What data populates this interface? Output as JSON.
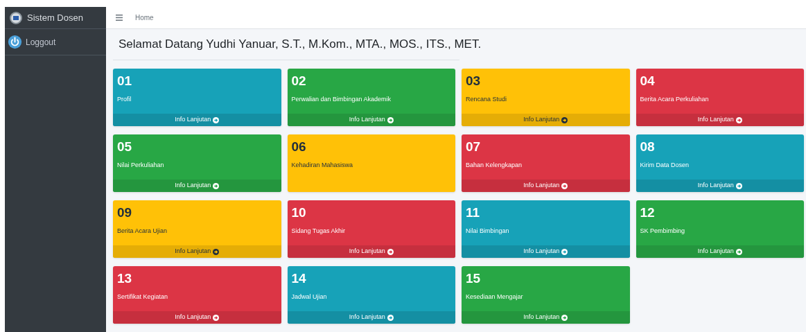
{
  "sidebar": {
    "brand": "Sistem Dosen",
    "items": [
      {
        "label": "Loggout"
      }
    ]
  },
  "header": {
    "breadcrumb": "Home"
  },
  "welcome": "Selamat Datang Yudhi Yanuar, S.T., M.Kom., MTA., MOS., ITS., MET.",
  "cards": [
    {
      "number": "01",
      "label": "Profil",
      "color": "#17a2b8",
      "footer": "Info Lanjutan"
    },
    {
      "number": "02",
      "label": "Perwalian dan Bimbingan Akademik",
      "color": "#28a745",
      "footer": "Info Lanjutan"
    },
    {
      "number": "03",
      "label": "Rencana Studi",
      "color": "#ffc107",
      "footer": "Info Lanjutan"
    },
    {
      "number": "04",
      "label": "Berita Acara Perkuliahan",
      "color": "#dc3545",
      "footer": "Info Lanjutan"
    },
    {
      "number": "05",
      "label": "Nilai Perkuliahan",
      "color": "#28a745",
      "footer": "Info Lanjutan"
    },
    {
      "number": "06",
      "label": "Kehadiran Mahasiswa",
      "color": "#ffc107"
    },
    {
      "number": "07",
      "label": "Bahan Kelengkapan",
      "color": "#dc3545",
      "footer": "Info Lanjutan"
    },
    {
      "number": "08",
      "label": "Kirim Data Dosen",
      "color": "#17a2b8",
      "footer": "Info Lanjutan"
    },
    {
      "number": "09",
      "label": "Berita Acara Ujian",
      "color": "#ffc107",
      "footer": "Info Lanjutan"
    },
    {
      "number": "10",
      "label": "Sidang Tugas Akhir",
      "color": "#dc3545",
      "footer": "Info Lanjutan"
    },
    {
      "number": "11",
      "label": "Nilai Bimbingan",
      "color": "#17a2b8",
      "footer": "Info Lanjutan"
    },
    {
      "number": "12",
      "label": "SK Pembimbing",
      "color": "#28a745",
      "footer": "Info Lanjutan"
    },
    {
      "number": "13",
      "label": "Sertifikat Kegiatan",
      "color": "#dc3545",
      "footer": "Info Lanjutan"
    },
    {
      "number": "14",
      "label": "Jadwal Ujian",
      "color": "#17a2b8",
      "footer": "Info Lanjutan"
    },
    {
      "number": "15",
      "label": "Kesediaan Mengajar",
      "color": "#28a745",
      "footer": "Info Lanjutan"
    }
  ]
}
